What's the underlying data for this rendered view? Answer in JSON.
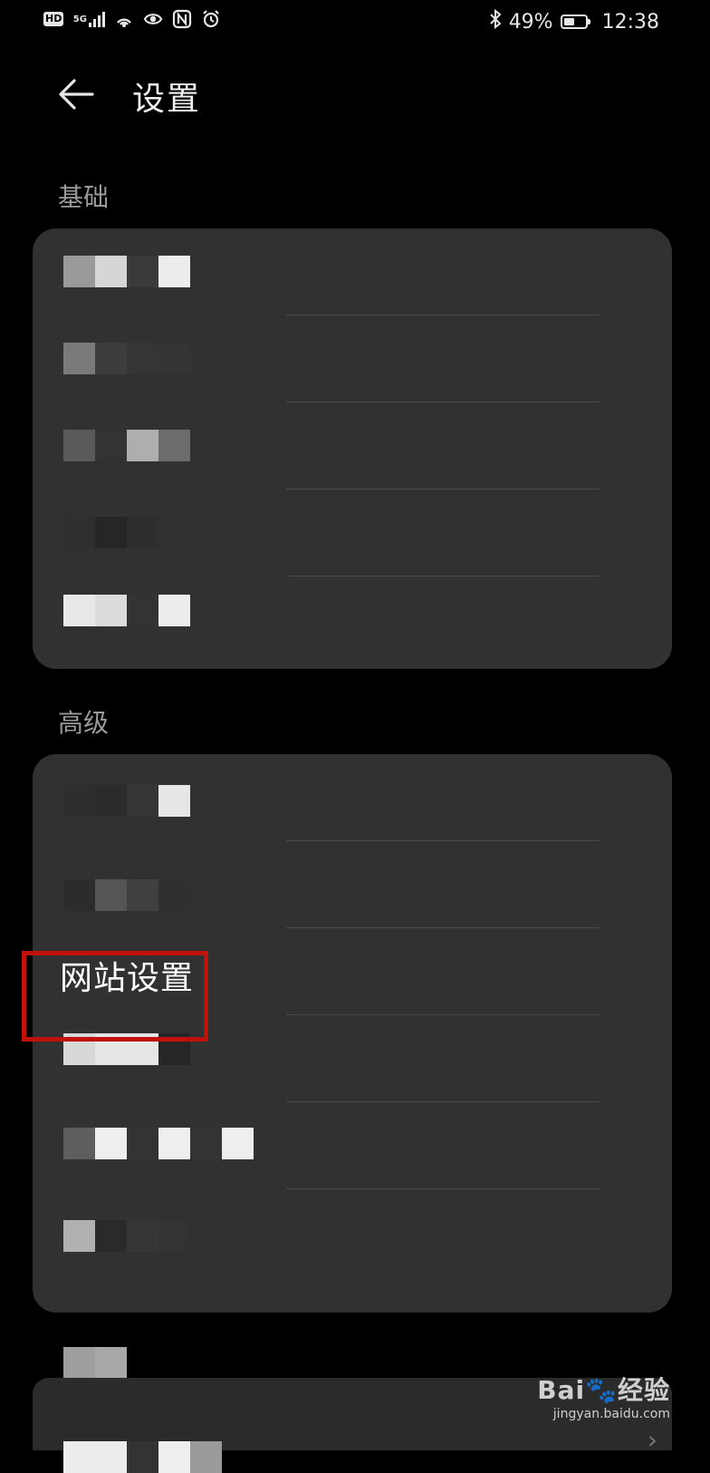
{
  "status_bar": {
    "left_icons": [
      "hd-icon",
      "5g-signal-icon",
      "hotspot-icon",
      "eye-comfort-icon",
      "nfc-icon",
      "alarm-icon"
    ],
    "hd_label": "HD",
    "net_label": "5G",
    "battery_percent": "49%",
    "battery_level": 0.49,
    "time": "12:38"
  },
  "header": {
    "title": "设置"
  },
  "sections": [
    {
      "label": "基础"
    },
    {
      "label": "高级"
    }
  ],
  "advanced": {
    "site_settings_label": "网站设置"
  },
  "watermark": {
    "brand": "Bai🐾经验",
    "url": "jingyan.baidu.com"
  },
  "colors": {
    "background": "#000000",
    "card": "#313131",
    "highlight": "#c0120d"
  }
}
